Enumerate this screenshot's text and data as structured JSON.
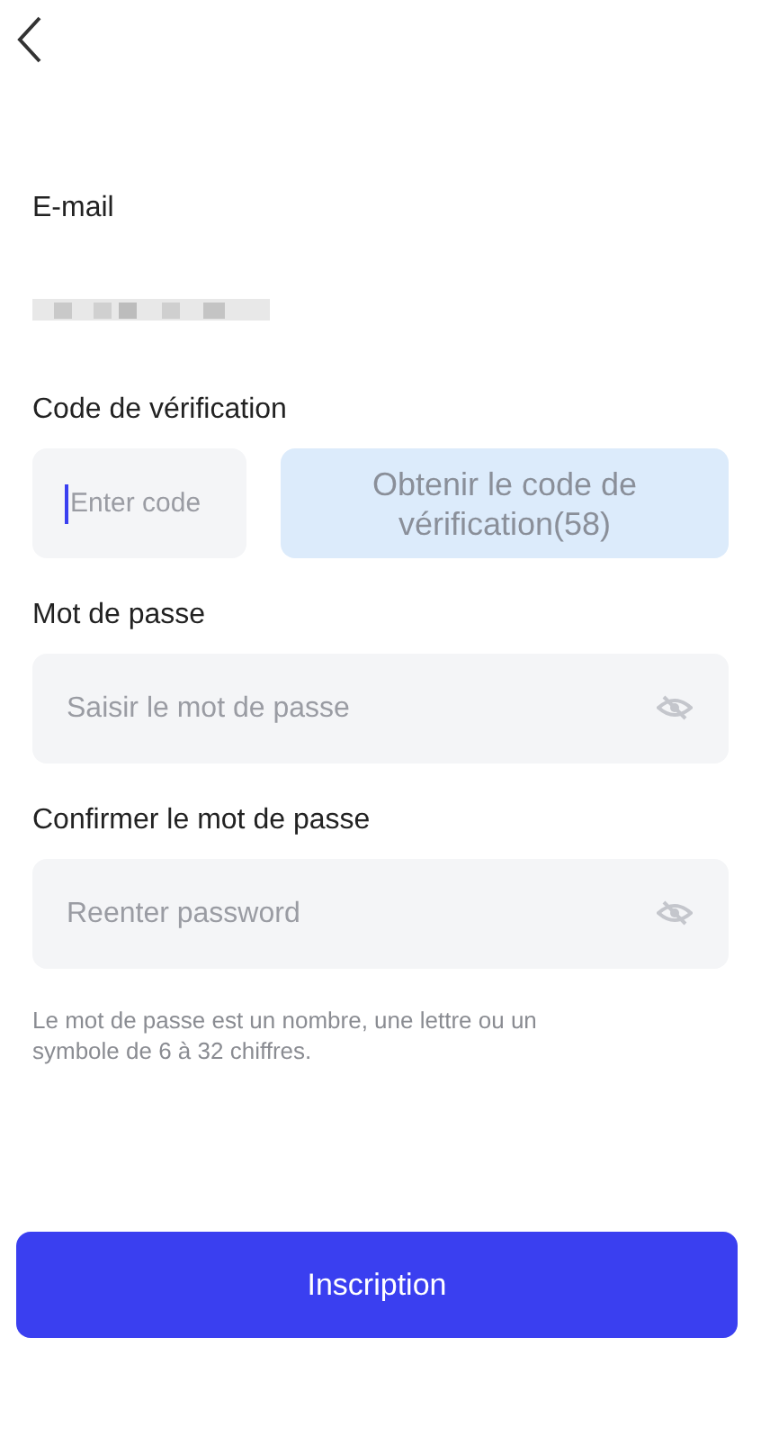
{
  "email": {
    "label": "E-mail",
    "redacted": true
  },
  "code": {
    "label": "Code de vérification",
    "placeholder": "Enter code",
    "focused": true,
    "send_button": "Obtenir le code de vérification(58)",
    "send_disabled": true
  },
  "password_fields": [
    {
      "label": "Mot de passe",
      "placeholder": "Saisir le mot de passe",
      "visible": false
    },
    {
      "label": "Confirmer le mot de passe",
      "placeholder": "Reenter password",
      "visible": false
    }
  ],
  "hint": "Le mot de passe est un nombre, une lettre ou un symbole de 6 à 32 chiffres.",
  "submit": "Inscription"
}
